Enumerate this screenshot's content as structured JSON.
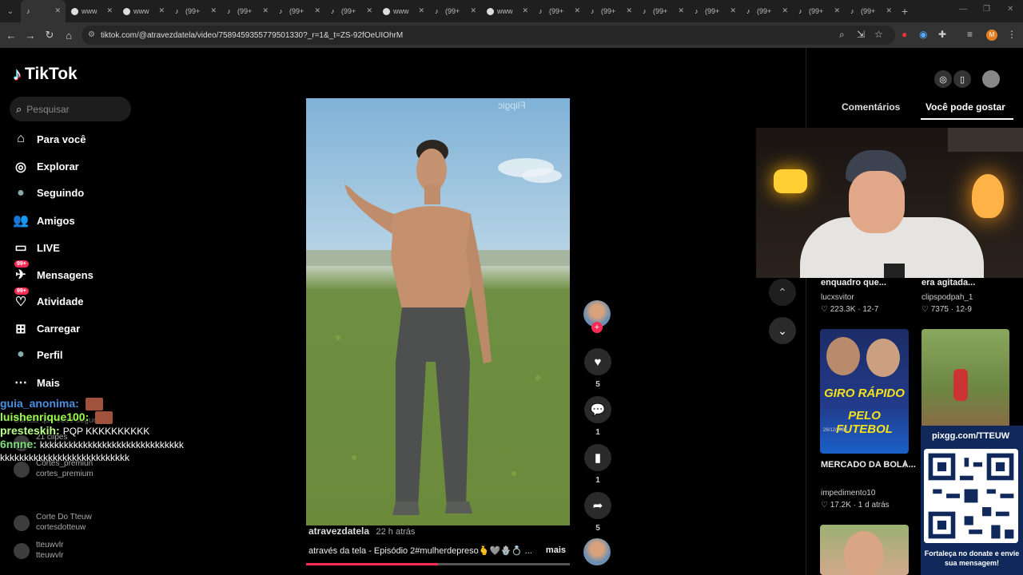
{
  "browser": {
    "tabs": [
      {
        "label": "",
        "icon": "tiktok-icon",
        "active": true
      },
      {
        "label": "www",
        "icon": "globe-icon"
      },
      {
        "label": "www",
        "icon": "globe-icon"
      },
      {
        "label": "(99+",
        "icon": "tiktok-icon"
      },
      {
        "label": "(99+",
        "icon": "tiktok-icon"
      },
      {
        "label": "(99+",
        "icon": "tiktok-icon"
      },
      {
        "label": "(99+",
        "icon": "tiktok-icon"
      },
      {
        "label": "www",
        "icon": "globe-icon"
      },
      {
        "label": "(99+",
        "icon": "tiktok-icon"
      },
      {
        "label": "www",
        "icon": "globe-icon"
      },
      {
        "label": "(99+",
        "icon": "tiktok-icon"
      },
      {
        "label": "(99+",
        "icon": "tiktok-icon"
      },
      {
        "label": "(99+",
        "icon": "tiktok-icon"
      },
      {
        "label": "(99+",
        "icon": "tiktok-icon"
      },
      {
        "label": "(99+",
        "icon": "tiktok-icon"
      },
      {
        "label": "(99+",
        "icon": "tiktok-icon"
      },
      {
        "label": "(99+",
        "icon": "tiktok-icon"
      }
    ],
    "url": "tiktok.com/@atravezdatela/video/7589459355779501330?_r=1&_t=ZS-92fOeUIOhrM"
  },
  "sidebar": {
    "logo": "TikTok",
    "search_placeholder": "Pesquisar",
    "items": [
      {
        "label": "Para você",
        "icon": "home-icon"
      },
      {
        "label": "Explorar",
        "icon": "compass-icon"
      },
      {
        "label": "Seguindo",
        "icon": "following-avatar-icon"
      },
      {
        "label": "Amigos",
        "icon": "friends-icon"
      },
      {
        "label": "LIVE",
        "icon": "live-icon"
      },
      {
        "label": "Mensagens",
        "icon": "messages-icon",
        "badge": "99+"
      },
      {
        "label": "Atividade",
        "icon": "activity-icon",
        "badge": "99+"
      },
      {
        "label": "Carregar",
        "icon": "upload-icon"
      },
      {
        "label": "Perfil",
        "icon": "profile-icon"
      },
      {
        "label": "Mais",
        "icon": "more-icon"
      }
    ]
  },
  "chat": {
    "messages": [
      {
        "user": "guia_anonima:",
        "text": "",
        "color": "#4a90e2"
      },
      {
        "user": "luishenrique100:",
        "text": "",
        "color": "#9cff4a"
      },
      {
        "user": "presteskih:",
        "text": "PQP KKKKKKKKKK",
        "color": "#b9ff8a"
      },
      {
        "user": "6nnne:",
        "text": "kkkkkkkkkkkkkkkkkkkkkkkkkkkkkkkkkkkkkkkkkkkkkkkkkkkkkkkkk",
        "color": "#7de07d"
      }
    ],
    "ghost": {
      "following_header": "Contas que você segue",
      "accounts": [
        {
          "name": "21 clipes",
          "handle": ""
        },
        {
          "name": "Cortes_premiun",
          "handle": "cortes_premium"
        },
        {
          "name": "Corte Do Tteuw",
          "handle": "cortesdotteuw"
        },
        {
          "name": "tteuwvlr",
          "handle": "tteuwvlr"
        }
      ]
    }
  },
  "video": {
    "watermark": "Flipgic",
    "author": "atravezdatela",
    "time_ago": "22 h atrás",
    "caption": "através da tela - Episódio 2#mulherdepreso🫰🩶🪬💍 ...",
    "more": "mais",
    "progress": 0.5,
    "likes": "5",
    "comments": "1",
    "saves": "1",
    "shares": "5"
  },
  "right_panel": {
    "tabs": [
      "Comentários",
      "Você pode gostar"
    ],
    "active_tab": 1,
    "cards": [
      {
        "title": "enquadro que...",
        "user": "lucxsvitor",
        "stats": "♡ 223.3K · 12-7"
      },
      {
        "title": "era agitada...",
        "user": "clipspodpah_1",
        "stats": "♡ 7375 · 12-9"
      },
      {
        "title": "MERCADO DA BOLA...",
        "user": "impedimento10",
        "stats": "♡ 17.2K · 1 d atrás",
        "thumb_text_1": "GIRO RÁPIDO",
        "thumb_text_2": "PELO FUTEBOL",
        "thumb_tag": "26/12/2025"
      }
    ]
  },
  "donation": {
    "url": "pixgg.com/TTEUW",
    "text": "Fortaleça no donate e envie sua mensagem!"
  },
  "colors": {
    "accent": "#fe2c55",
    "bg": "#000000",
    "donation_bg": "#10285a"
  }
}
